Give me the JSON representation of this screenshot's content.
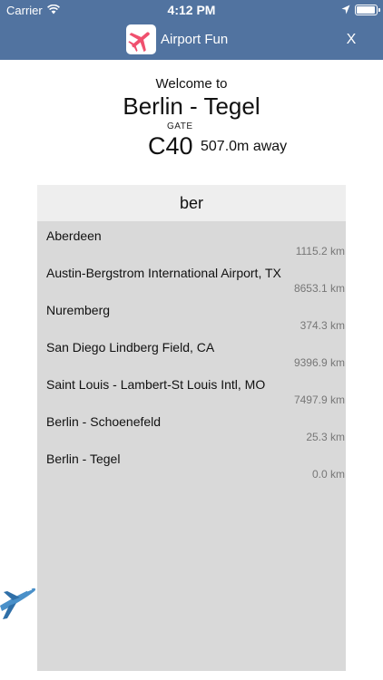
{
  "status_bar": {
    "carrier": "Carrier",
    "time": "4:12 PM"
  },
  "nav": {
    "title": "Airport Fun",
    "close_label": "X",
    "logo_icon": "airplane-icon",
    "accent_color": "#5173a0",
    "logo_color": "#f0506e"
  },
  "header": {
    "welcome": "Welcome to",
    "airport": "Berlin - Tegel",
    "gate_label": "GATE",
    "gate": "C40",
    "distance": "507.0m away"
  },
  "search": {
    "value": "ber"
  },
  "results": [
    {
      "name": "Aberdeen",
      "distance": "1115.2 km"
    },
    {
      "name": "Austin-Bergstrom International Airport, TX",
      "distance": "8653.1 km"
    },
    {
      "name": "Nuremberg",
      "distance": "374.3 km"
    },
    {
      "name": "San Diego Lindberg Field, CA",
      "distance": "9396.9 km"
    },
    {
      "name": "Saint Louis - Lambert-St Louis Intl, MO",
      "distance": "7497.9 km"
    },
    {
      "name": "Berlin - Schoenefeld",
      "distance": "25.3 km"
    },
    {
      "name": "Berlin - Tegel",
      "distance": "0.0 km"
    }
  ]
}
